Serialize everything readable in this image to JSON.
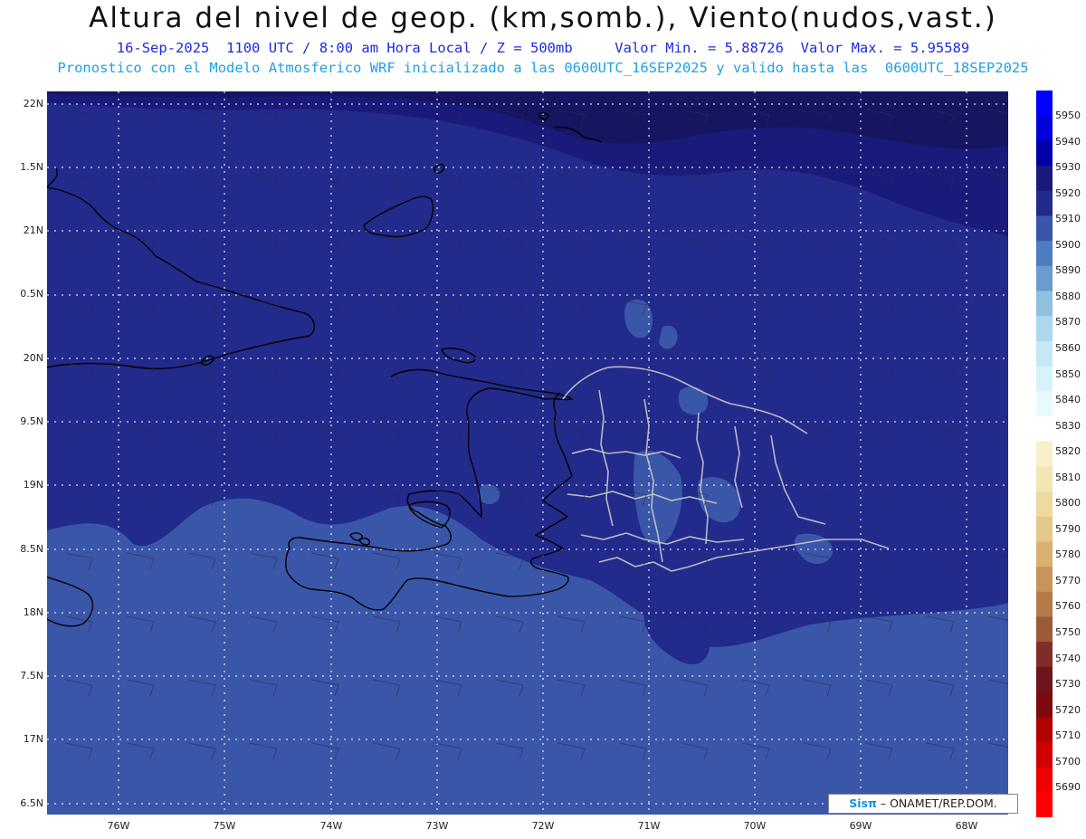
{
  "header": {
    "title": "Altura del nivel de geop. (km,somb.), Viento(nudos,vast.)",
    "subtitle1": "16-Sep-2025  1100 UTC / 8:00 am Hora Local / Z = 500mb     Valor Min. = 5.88726  Valor Max. = 5.95589",
    "subtitle2": "Pronostico con el Modelo Atmosferico WRF inicializado a las 0600UTC_16SEP2025 y valido hasta las  0600UTC_18SEP2025"
  },
  "axes": {
    "lat_labels": [
      "22N",
      "1.5N",
      "21N",
      "0.5N",
      "20N",
      "9.5N",
      "19N",
      "8.5N",
      "18N",
      "7.5N",
      "17N",
      "6.5N"
    ],
    "lon_labels": [
      "76W",
      "75W",
      "74W",
      "73W",
      "72W",
      "71W",
      "70W",
      "69W",
      "68W"
    ]
  },
  "colorbar": {
    "labels": [
      "5950",
      "5940",
      "5930",
      "5920",
      "5910",
      "5900",
      "5890",
      "5880",
      "5870",
      "5860",
      "5850",
      "5840",
      "5830",
      "5820",
      "5810",
      "5800",
      "5790",
      "5780",
      "5770",
      "5760",
      "5750",
      "5740",
      "5730",
      "5720",
      "5710",
      "5700",
      "5690"
    ],
    "colors": [
      "#0000ff",
      "#0000dd",
      "#0000aa",
      "#1a1a7a",
      "#222a8c",
      "#3a56a8",
      "#4e7cc0",
      "#6a9ccf",
      "#8fc0e0",
      "#acd8ec",
      "#c4e9f4",
      "#d8f2f9",
      "#e8faff",
      "#ffffff",
      "#f8f0c8",
      "#f2e6b4",
      "#ecdaa0",
      "#e4c88a",
      "#d8b070",
      "#c8945c",
      "#b47a48",
      "#9c5a38",
      "#822c28",
      "#6e141c",
      "#7a0a10",
      "#b00000",
      "#d00000",
      "#ee0000",
      "#ff0000"
    ]
  },
  "map": {
    "colors": {
      "lowest_level": "#3a56a8",
      "mid_level": "#222a8c",
      "high_level": "#1a1a7a",
      "max_level": "#151562",
      "coast": "#000000",
      "borders": "#c8c8c8",
      "grid": "#ffffff"
    }
  },
  "credit": {
    "sis": "Sisπ",
    "text": "– ONAMET/REP.DOM."
  }
}
